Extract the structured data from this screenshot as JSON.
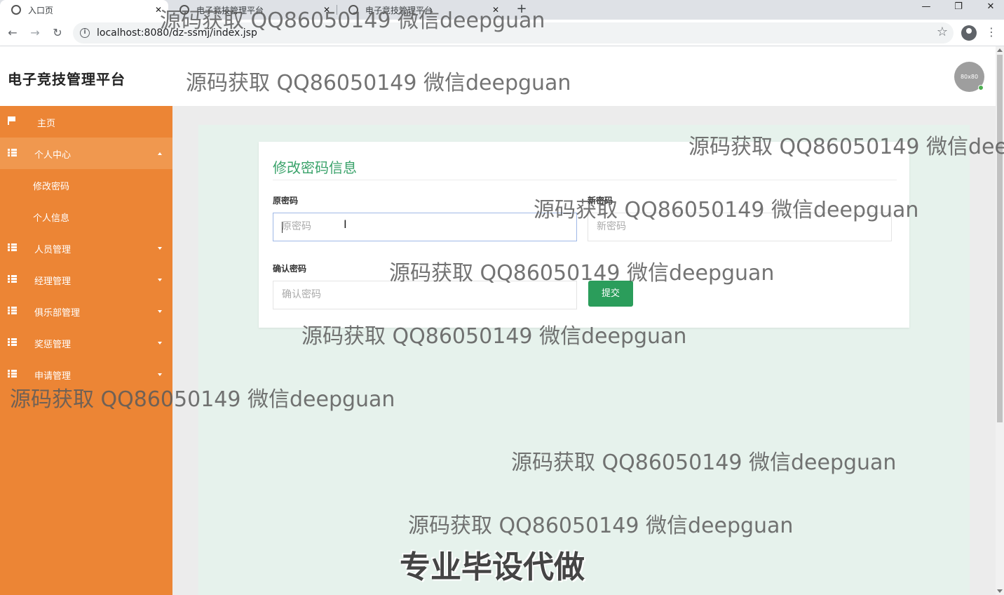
{
  "browser": {
    "tabs": [
      {
        "label": "入口页",
        "active": true
      },
      {
        "label": "电子竞技管理平台",
        "active": false
      },
      {
        "label": "电子竞技管理平台",
        "active": false
      }
    ],
    "tab_close": "✕",
    "new_tab": "+",
    "url": "localhost:8080/dz-ssmj/index.jsp",
    "window_controls": {
      "minimize": "—",
      "maximize": "❐",
      "close": "✕"
    }
  },
  "header": {
    "title": "电子竞技管理平台",
    "avatar_text": "80x80"
  },
  "sidebar": {
    "home": "主页",
    "personal_center": "个人中心",
    "sub_items": [
      "修改密码",
      "个人信息"
    ],
    "groups": [
      "人员管理",
      "经理管理",
      "俱乐部管理",
      "奖惩管理",
      "申请管理"
    ]
  },
  "form": {
    "title": "修改密码信息",
    "old_password": {
      "label": "原密码",
      "placeholder": "原密码"
    },
    "new_password": {
      "label": "新密码",
      "placeholder": "新密码"
    },
    "confirm_password": {
      "label": "确认密码",
      "placeholder": "确认密码"
    },
    "submit": "提交"
  },
  "watermark": {
    "text": "源码获取 QQ86050149 微信deepguan",
    "banner": "专业毕设代做"
  },
  "colors": {
    "sidebar": "#ec8535",
    "sidebar_active": "#f0984f",
    "accent_green": "#3ba36b",
    "button_green": "#2b9d5b",
    "main_bg": "#e6f2ec"
  }
}
